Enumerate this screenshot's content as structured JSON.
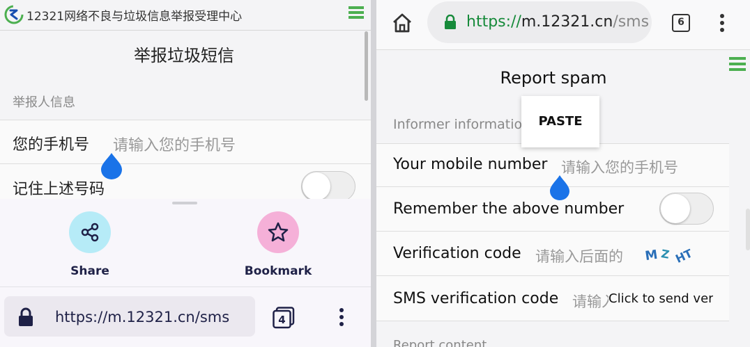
{
  "left": {
    "site_name": "12321网络不良与垃圾信息举报受理中心",
    "page_title": "举报垃圾短信",
    "section_label": "举报人信息",
    "phone_label": "您的手机号",
    "phone_placeholder": "请输入您的手机号",
    "remember_label": "记住上述号码",
    "remember_on": false,
    "share_label": "Share",
    "bookmark_label": "Bookmark",
    "url": "https://m.12321.cn/sms",
    "tab_count": "4",
    "icons": [
      "logo-icon",
      "menu-icon",
      "share-icon",
      "star-icon",
      "lock-icon",
      "tabs-icon",
      "more-icon",
      "text-handle-icon"
    ]
  },
  "right": {
    "url_scheme": "https://",
    "url_host": "m.12321.cn",
    "url_path": "/sms",
    "tab_count": "6",
    "page_title": "Report spam",
    "section_label": "Informer information",
    "paste_label": "PASTE",
    "mobile_label": "Your mobile number",
    "mobile_placeholder": "请输入您的手机号",
    "remember_label": "Remember the above number",
    "remember_on": false,
    "verification_label": "Verification code",
    "verification_placeholder": "请输入后面的",
    "captcha_text": "M Z HT",
    "sms_label": "SMS verification code",
    "sms_placeholder": "请输入",
    "send_code_label": "Click to send verification code",
    "report_section_label": "Report content",
    "icons": [
      "home-icon",
      "lock-icon",
      "tabs-icon",
      "more-icon",
      "menu-icon",
      "text-handle-icon"
    ]
  },
  "colors": {
    "accent_green": "#4caf50",
    "secure_green": "#168a3a",
    "handle_blue": "#1a73e8",
    "share_circle": "#b6ebf7",
    "bookmark_circle": "#f5b0d8",
    "navy_text": "#1f2147"
  }
}
